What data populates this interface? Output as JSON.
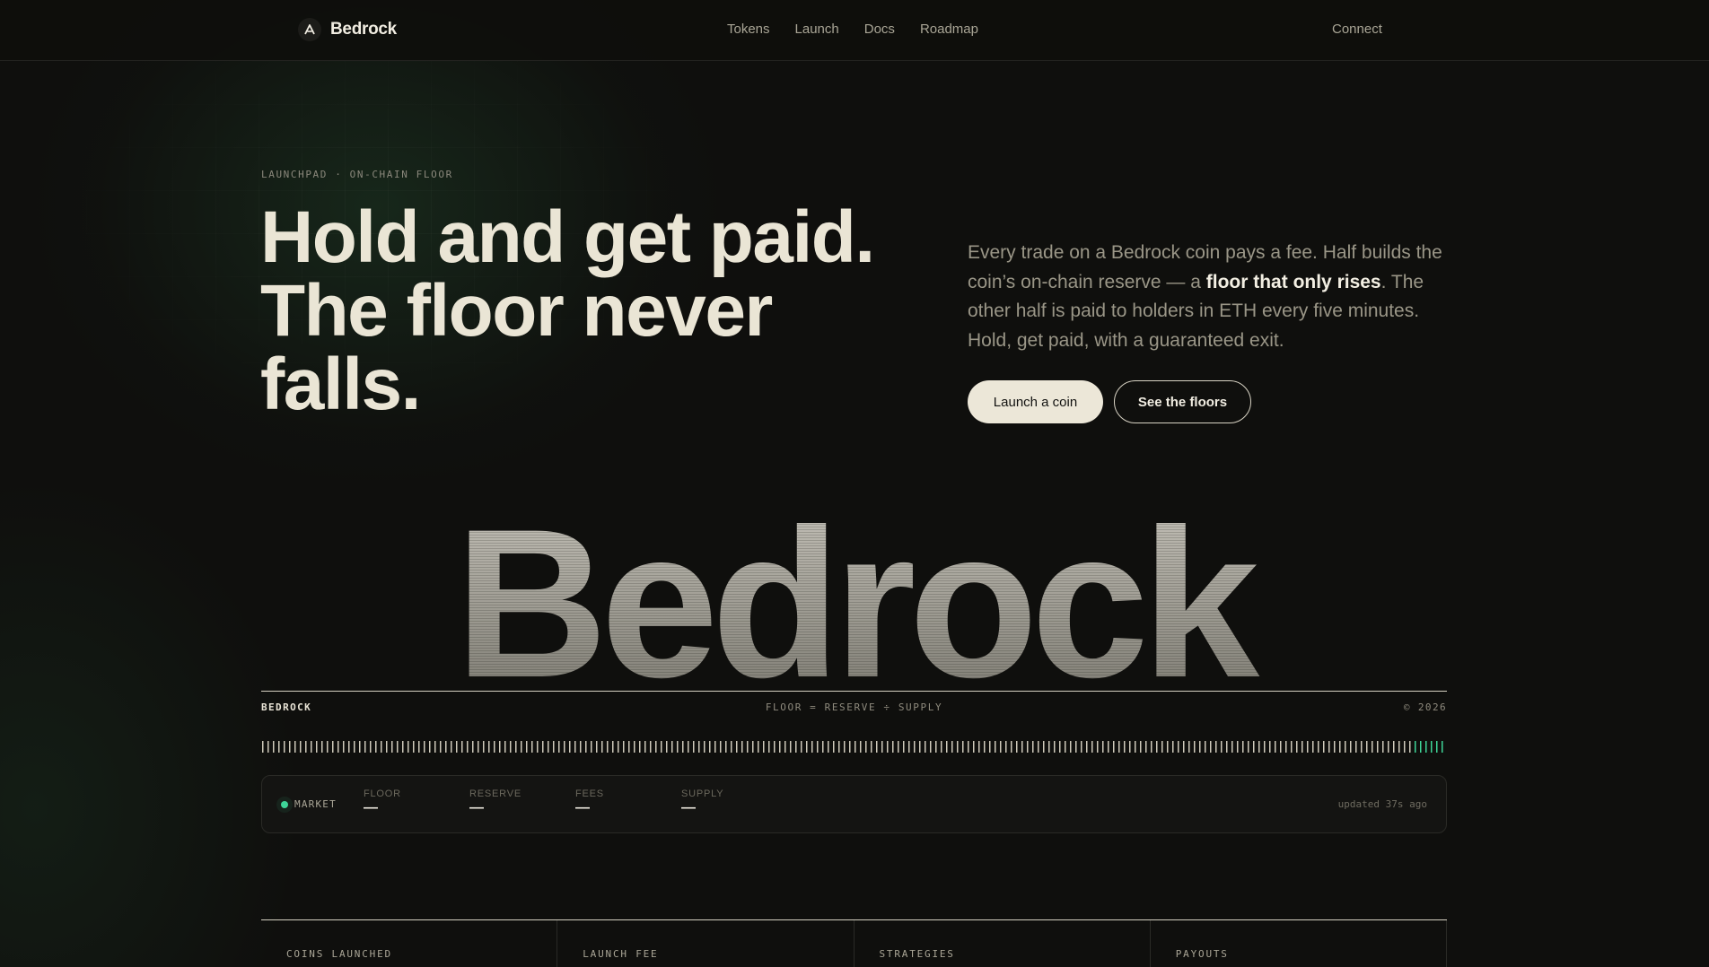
{
  "nav": {
    "brand": "Bedrock",
    "links": [
      "Tokens",
      "Launch",
      "Docs",
      "Roadmap"
    ],
    "connect": "Connect"
  },
  "hero": {
    "eyebrow": "LAUNCHPAD · ON-CHAIN FLOOR",
    "headline": [
      "Hold and get paid.",
      "The floor never",
      "falls."
    ],
    "description": {
      "before": "Every trade on a Bedrock coin pays a fee. Half builds the coin’s on-chain reserve — a ",
      "bold": "floor that only rises",
      "after": ". The other half is paid to holders in ETH every five minutes. Hold, get paid, with a guaranteed exit."
    },
    "primary_cta": "Launch a coin",
    "secondary_cta": "See the floors"
  },
  "wordmark": "Bedrock",
  "meta": {
    "left": "BEDROCK",
    "center": "FLOOR = RESERVE ÷ SUPPLY",
    "right": "© 2026"
  },
  "market": {
    "label": "MARKET",
    "stats": [
      {
        "label": "FLOOR",
        "value": "—"
      },
      {
        "label": "RESERVE",
        "value": "—"
      },
      {
        "label": "FEES",
        "value": "—"
      },
      {
        "label": "SUPPLY",
        "value": "—"
      }
    ],
    "updated": "updated 37s ago"
  },
  "bottom_stats": [
    "COINS LAUNCHED",
    "LAUNCH FEE",
    "STRATEGIES",
    "PAYOUTS"
  ],
  "colors": {
    "background": "#0f0f0d",
    "text": "#eae5d5",
    "accent_green": "#3ed598",
    "muted": "#9a9687"
  }
}
